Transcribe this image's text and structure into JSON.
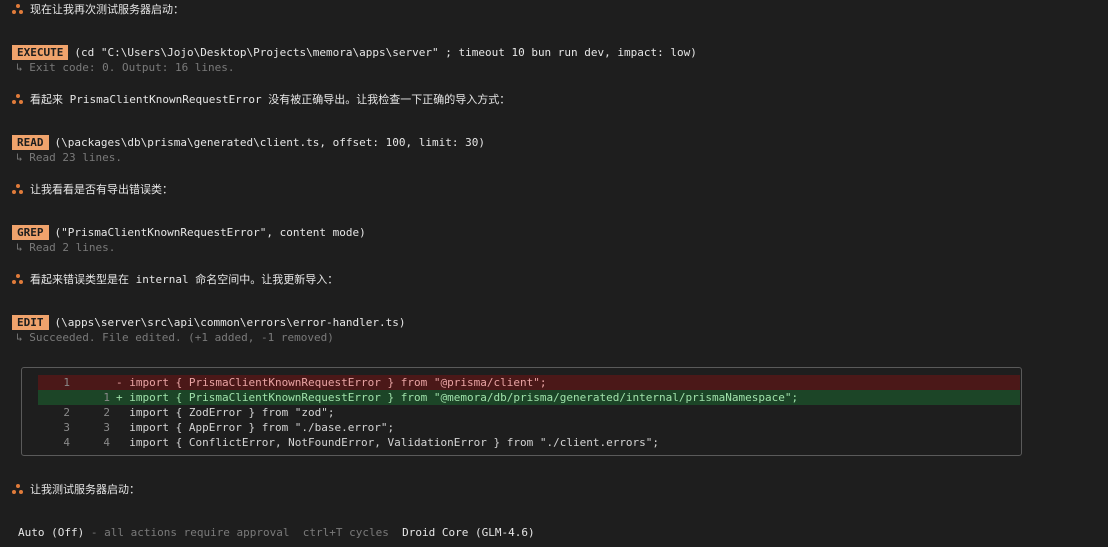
{
  "messages": [
    "现在让我再次测试服务器启动：",
    "看起来 PrismaClientKnownRequestError 没有被正确导出。让我检查一下正确的导入方式：",
    "让我看看是否有导出错误类：",
    "看起来错误类型是在 internal 命名空间中。让我更新导入：",
    "让我测试服务器启动："
  ],
  "tools": [
    {
      "badge": "EXECUTE",
      "args": "(cd \"C:\\Users\\Jojo\\Desktop\\Projects\\memora\\apps\\server\" ; timeout 10 bun run dev, impact: low)",
      "result": "↳ Exit code: 0. Output: 16 lines."
    },
    {
      "badge": "READ",
      "args": "(\\packages\\db\\prisma\\generated\\client.ts, offset: 100, limit: 30)",
      "result": "↳ Read 23 lines."
    },
    {
      "badge": "GREP",
      "args": "(\"PrismaClientKnownRequestError\", content mode)",
      "result": "↳ Read 2 lines."
    },
    {
      "badge": "EDIT",
      "args": "(\\apps\\server\\src\\api\\common\\errors\\error-handler.ts)",
      "result": "↳ Succeeded. File edited. (+1 added, -1 removed)"
    }
  ],
  "diff": [
    {
      "type": "del",
      "old": "1",
      "new": "",
      "code": "- import { PrismaClientKnownRequestError } from \"@prisma/client\";"
    },
    {
      "type": "add",
      "old": "",
      "new": "1",
      "code": "+ import { PrismaClientKnownRequestError } from \"@memora/db/prisma/generated/internal/prismaNamespace\";"
    },
    {
      "type": "ctx",
      "old": "2",
      "new": "2",
      "code": "  import { ZodError } from \"zod\";"
    },
    {
      "type": "ctx",
      "old": "3",
      "new": "3",
      "code": "  import { AppError } from \"./base.error\";"
    },
    {
      "type": "ctx",
      "old": "4",
      "new": "4",
      "code": "  import { ConflictError, NotFoundError, ValidationError } from \"./client.errors\";"
    }
  ],
  "status": {
    "mode": "Auto (Off)",
    "mode_desc": "- all actions require approval",
    "shortcut": "ctrl+T cycles",
    "model": "Droid Core (GLM-4.6)"
  }
}
